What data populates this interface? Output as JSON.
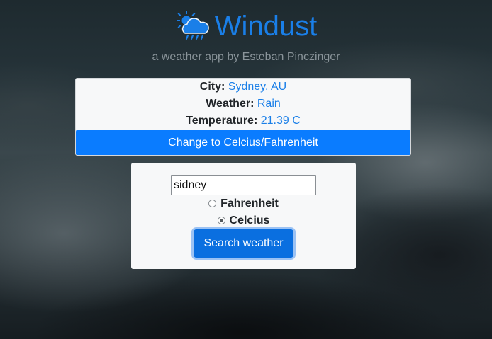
{
  "app": {
    "title": "Windust",
    "subtitle": "a weather app by Esteban Pinczinger",
    "logo_icon": "weather-rain-sun-icon",
    "accent_color": "#1a7fe8"
  },
  "info": {
    "city_label": "City:",
    "city_value": "Sydney, AU",
    "weather_label": "Weather:",
    "weather_value": "Rain",
    "temperature_label": "Temperature:",
    "temperature_value": "21.39 C",
    "toggle_button_label": "Change to Celcius/Fahrenheit"
  },
  "search": {
    "input_value": "sidney",
    "unit_options": [
      {
        "label": "Fahrenheit",
        "checked": false
      },
      {
        "label": "Celcius",
        "checked": true
      }
    ],
    "submit_label": "Search weather"
  }
}
